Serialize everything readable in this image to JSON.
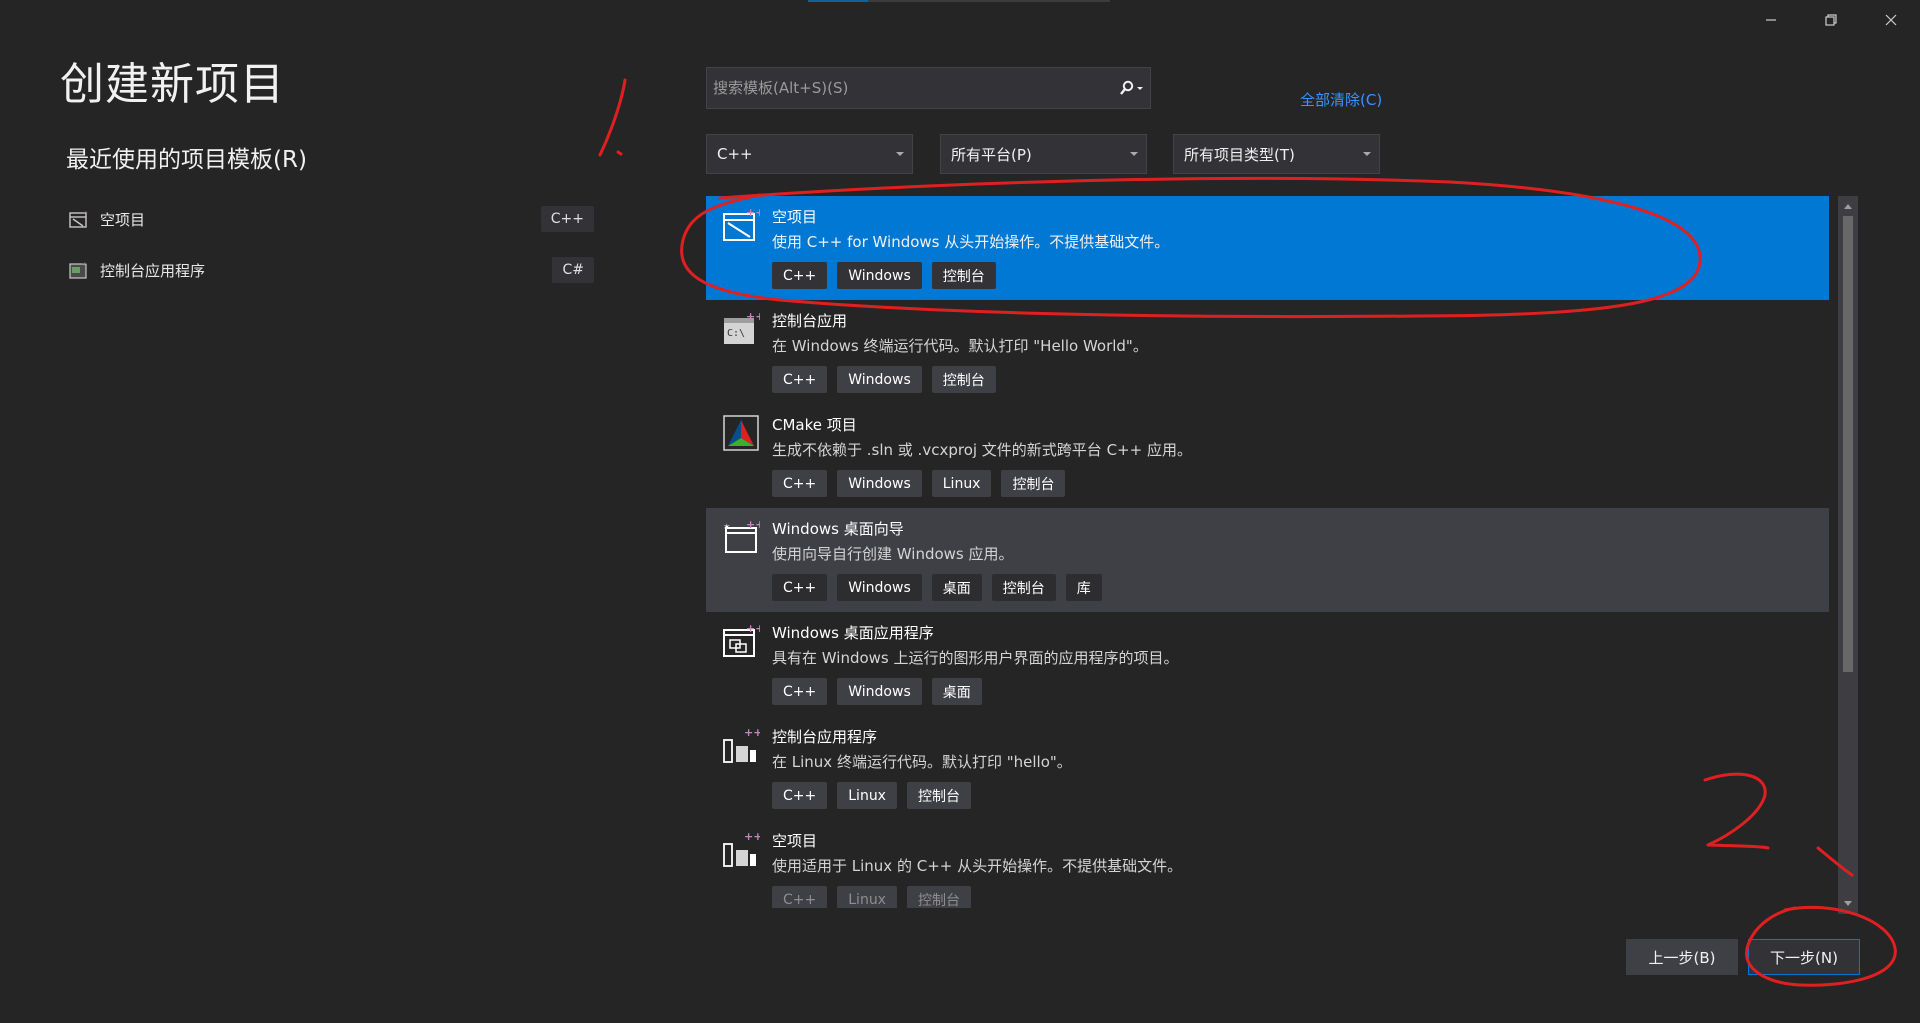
{
  "window": {
    "minimize_icon": "minimize-icon",
    "restore_icon": "restore-icon",
    "close_icon": "close-icon"
  },
  "page": {
    "title": "创建新项目"
  },
  "recent": {
    "heading": "最近使用的项目模板(R)",
    "items": [
      {
        "label": "空项目",
        "lang": "C++",
        "icon": "empty-project-icon"
      },
      {
        "label": "控制台应用程序",
        "lang": "C#",
        "icon": "console-app-icon"
      }
    ]
  },
  "search": {
    "placeholder": "搜索模板(Alt+S)(S)",
    "value": "",
    "icon": "search-icon"
  },
  "clear_all": "全部清除(C)",
  "filters": {
    "language": "C++",
    "platform": "所有平台(P)",
    "project_type": "所有项目类型(T)"
  },
  "templates": [
    {
      "name": "空项目",
      "desc": "使用 C++ for Windows 从头开始操作。不提供基础文件。",
      "tags": [
        "C++",
        "Windows",
        "控制台"
      ],
      "icon": "empty-project-icon",
      "state": "selected"
    },
    {
      "name": "控制台应用",
      "desc": "在 Windows 终端运行代码。默认打印 \"Hello World\"。",
      "tags": [
        "C++",
        "Windows",
        "控制台"
      ],
      "icon": "console-app-icon",
      "state": "normal"
    },
    {
      "name": "CMake 项目",
      "desc": "生成不依赖于 .sln 或 .vcxproj 文件的新式跨平台 C++ 应用。",
      "tags": [
        "C++",
        "Windows",
        "Linux",
        "控制台"
      ],
      "icon": "cmake-icon",
      "state": "normal"
    },
    {
      "name": "Windows 桌面向导",
      "desc": "使用向导自行创建 Windows 应用。",
      "tags": [
        "C++",
        "Windows",
        "桌面",
        "控制台",
        "库"
      ],
      "icon": "desktop-wizard-icon",
      "state": "hover"
    },
    {
      "name": "Windows 桌面应用程序",
      "desc": "具有在 Windows 上运行的图形用户界面的应用程序的项目。",
      "tags": [
        "C++",
        "Windows",
        "桌面"
      ],
      "icon": "desktop-app-icon",
      "state": "normal"
    },
    {
      "name": "控制台应用程序",
      "desc": "在 Linux 终端运行代码。默认打印 \"hello\"。",
      "tags": [
        "C++",
        "Linux",
        "控制台"
      ],
      "icon": "linux-console-icon",
      "state": "normal"
    },
    {
      "name": "空项目",
      "desc": "使用适用于 Linux 的 C++ 从头开始操作。不提供基础文件。",
      "tags": [
        "C++",
        "Linux",
        "控制台"
      ],
      "icon": "linux-empty-icon",
      "state": "faded"
    }
  ],
  "buttons": {
    "back": "上一步(B)",
    "next": "下一步(N)"
  },
  "colors": {
    "selected": "#0078d4",
    "link": "#3794ff",
    "annotation": "#e02020"
  }
}
